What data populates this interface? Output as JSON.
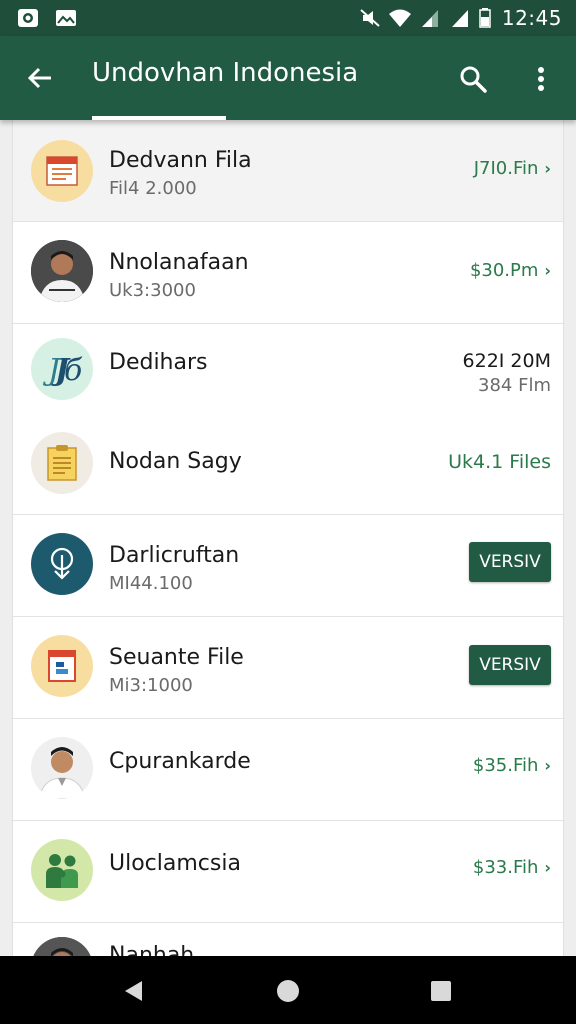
{
  "status_bar": {
    "time": "12:45",
    "left_icons": [
      "circle-app-icon",
      "image-icon"
    ],
    "right_icons": [
      "mute-icon",
      "wifi-icon",
      "signal-icon",
      "signal-icon",
      "battery-icon"
    ]
  },
  "app_bar": {
    "title": "Undovhan Indonesia",
    "icons": [
      "back-arrow-icon",
      "search-icon",
      "more-vert-icon"
    ]
  },
  "colors": {
    "status_bar": "#1f4f3a",
    "app_bar": "#215b43",
    "accent_green": "#2b7a4b",
    "button": "#215b43"
  },
  "rows": [
    {
      "title": "Dedvann Fila",
      "subtitle": "Fil4 2.000",
      "price": "J7I0.Fin",
      "icon": "document-icon"
    },
    {
      "title": "Nnolanafaan",
      "subtitle": "Uk3:3000",
      "price": "$30.Pm",
      "icon": "person-avatar"
    },
    {
      "title": "Dedihars",
      "price": "622I 20M",
      "price_sub": "384 Flm",
      "icon": "logo-jo-icon"
    },
    {
      "title": "Nodan Sagy",
      "price": "Uk4.1 Files",
      "icon": "notepad-icon"
    },
    {
      "title": "Darlicruftan",
      "subtitle": "MI44.100",
      "button": "VERSIV",
      "icon": "download-icon"
    },
    {
      "title": "Seuante File",
      "subtitle": "Mi3:1000",
      "button": "VERSIV",
      "icon": "file-chart-icon"
    },
    {
      "title": "Cpurankarde",
      "price": "$35.Fih",
      "icon": "person-avatar"
    },
    {
      "title": "Uloclamcsia",
      "price": "$33.Fih",
      "icon": "family-icon"
    },
    {
      "title": "Nanhah",
      "icon": "person-avatar"
    }
  ],
  "nav_bar": {
    "icons": [
      "nav-back-icon",
      "nav-home-icon",
      "nav-recents-icon"
    ]
  }
}
